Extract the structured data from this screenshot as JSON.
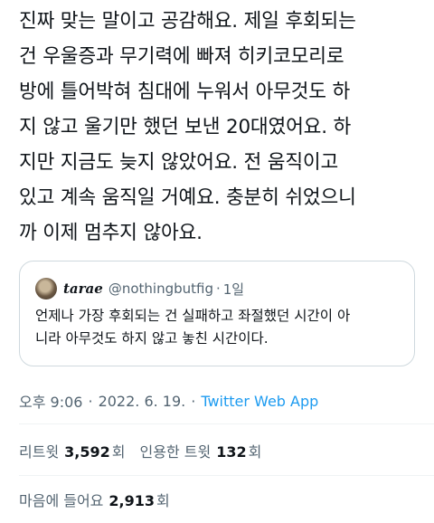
{
  "tweet": {
    "text": "진짜 맞는 말이고 공감해요. 제일 후회되는\n건 우울증과 무기력에 빠져 히키코모리로\n방에 틀어박혀 침대에 누워서 아무것도 하\n지 않고 울기만 했던 보낸 20대였어요. 하\n지만 지금도 늦지 않았어요. 전 움직이고\n있고 계속 움직일 거예요. 충분히 쉬었으니\n까 이제 멈추지 않아요."
  },
  "quote": {
    "name": "tarae",
    "handle": "@nothingbutfig",
    "separator": "·",
    "time": "1일",
    "text": "언제나 가장 후회되는 건 실패하고 좌절했던 시간이 아\n니라 아무것도 하지 않고 놓친 시간이다."
  },
  "meta": {
    "time": "오후 9:06",
    "dot1": "·",
    "date": "2022. 6. 19.",
    "dot2": "·",
    "source": "Twitter Web App"
  },
  "stats": {
    "retweets_label": "리트윗",
    "retweets_count": "3,592",
    "retweets_suffix": "회",
    "quotes_label": "인용한 트윗",
    "quotes_count": "132",
    "quotes_suffix": "회",
    "likes_label": "마음에 들어요",
    "likes_count": "2,913",
    "likes_suffix": "회"
  },
  "colors": {
    "text": "#0f1419",
    "secondary": "#536471",
    "link": "#1d9bf0",
    "border": "#cfd9de"
  }
}
